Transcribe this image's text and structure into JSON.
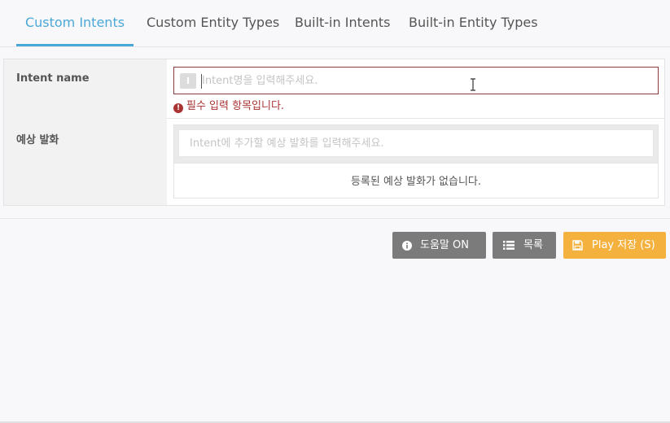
{
  "tabs": [
    {
      "label": "Custom Intents",
      "active": true
    },
    {
      "label": "Custom Entity Types",
      "active": false
    },
    {
      "label": "Built-in Intents",
      "active": false
    },
    {
      "label": "Built-in Entity Types",
      "active": false
    }
  ],
  "form": {
    "intent_name": {
      "label": "Intent name",
      "placeholder": "Intent명을 입력해주세요.",
      "value": "",
      "error": "필수 입력 항목입니다."
    },
    "utterances": {
      "label": "예상 발화",
      "placeholder": "Intent에 추가할 예상 발화를 입력해주세요.",
      "empty_message": "등록된 예상 발화가 없습니다."
    }
  },
  "buttons": {
    "help": {
      "label": "도움말 ON",
      "icon": "info-icon"
    },
    "list": {
      "label": "목록",
      "icon": "list-icon"
    },
    "save": {
      "label": "Play 저장 (S)",
      "icon": "save-icon"
    }
  },
  "colors": {
    "accent": "#4aa8d8",
    "error": "#a33333",
    "save_button": "#f5b13d",
    "gray_button": "#7b7b7b"
  }
}
